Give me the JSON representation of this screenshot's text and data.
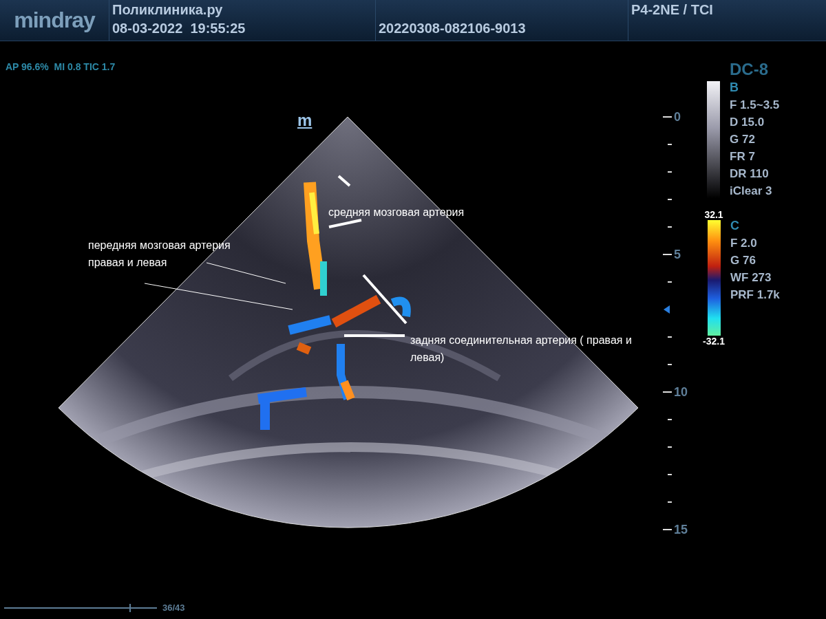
{
  "header": {
    "logo": "mindray",
    "clinic": "Поликлиника.ру",
    "datetime": "08-03-2022  19:55:25",
    "exam_id": "20220308-082106-9013",
    "probe": "P4-2NE / TCI"
  },
  "acoustic_output": "AP 96.6%  MI 0.8 TIC 1.7",
  "orientation_mark": "m",
  "annotations": [
    {
      "text": "средняя мозговая артерия"
    },
    {
      "text": "передняя мозговая артерия правая и левая"
    },
    {
      "text": "задняя соединительная артерия ( правая и левая)"
    }
  ],
  "depth_scale": [
    "0",
    "5",
    "10",
    "15"
  ],
  "preset": "DC-8",
  "b_mode": {
    "title": "B",
    "params": [
      "F 1.5~3.5",
      "D 15.0",
      "G 72",
      "FR 7",
      "DR 110",
      "iClear 3"
    ]
  },
  "color_mode": {
    "title": "C",
    "scale_max": "32.1",
    "scale_min": "-32.1",
    "params": [
      "F 2.0",
      "G 76",
      "WF 273",
      "PRF 1.7k"
    ]
  },
  "cine": {
    "frame": "36/43",
    "level": 0.82
  }
}
